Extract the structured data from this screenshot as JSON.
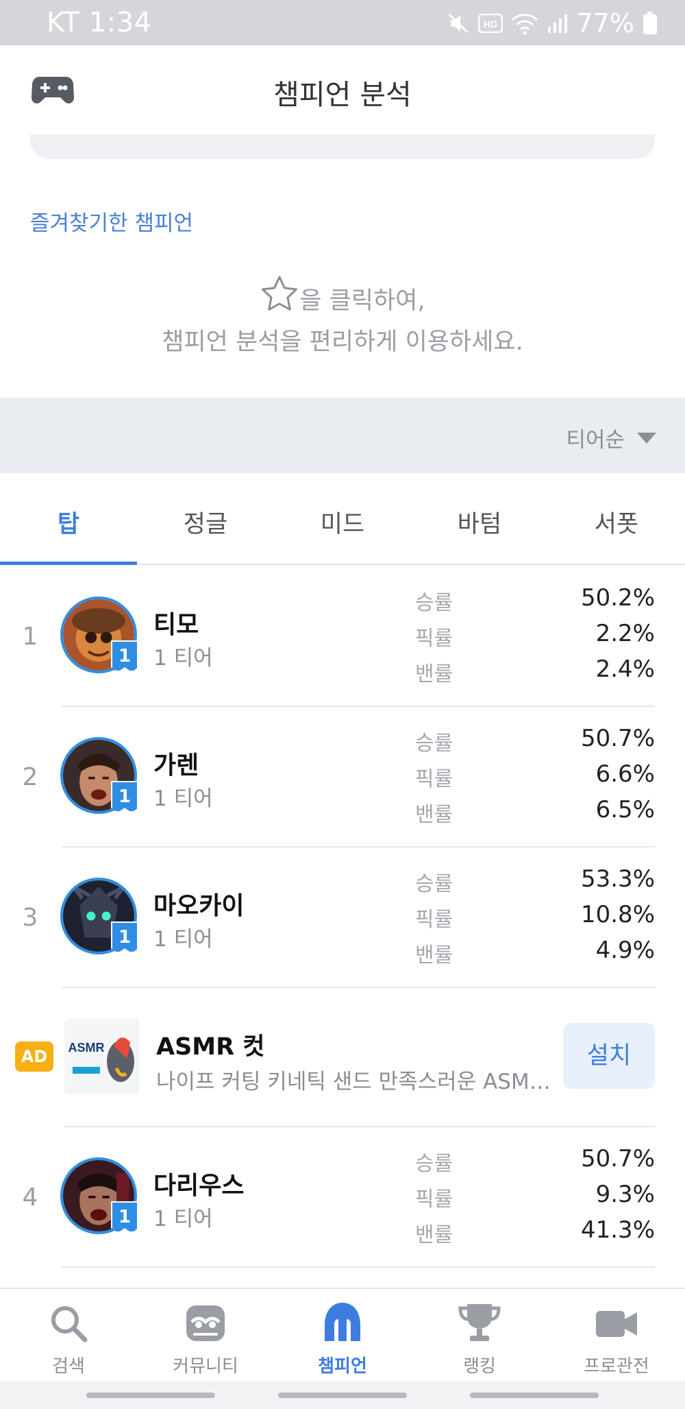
{
  "status_bar": {
    "carrier_time": "KT 1:34",
    "battery": "77%",
    "icons": [
      "mute-icon",
      "hd-icon",
      "wifi-icon",
      "signal-icon",
      "battery-icon"
    ]
  },
  "header": {
    "title": "챔피언 분석",
    "icon": "gamepad-icon"
  },
  "favorites": {
    "title": "즐겨찾기한 챔피언",
    "hint_line1": "을 클릭하여,",
    "hint_line2": "챔피언 분석을 편리하게 이용하세요.",
    "hint_icon": "star-outline-icon"
  },
  "sort": {
    "selected": "티어순",
    "icon": "dropdown-arrow-icon"
  },
  "tabs": [
    {
      "label": "탑",
      "active": true
    },
    {
      "label": "정글",
      "active": false
    },
    {
      "label": "미드",
      "active": false
    },
    {
      "label": "바텀",
      "active": false
    },
    {
      "label": "서폿",
      "active": false
    }
  ],
  "stat_labels": {
    "win": "승률",
    "pick": "픽률",
    "ban": "밴률"
  },
  "champions": [
    {
      "rank": "1",
      "name": "티모",
      "tier": "1 티어",
      "tier_badge": "1",
      "win": "50.2%",
      "pick": "2.2%",
      "ban": "2.4%"
    },
    {
      "rank": "2",
      "name": "가렌",
      "tier": "1 티어",
      "tier_badge": "1",
      "win": "50.7%",
      "pick": "6.6%",
      "ban": "6.5%"
    },
    {
      "rank": "3",
      "name": "마오카이",
      "tier": "1 티어",
      "tier_badge": "1",
      "win": "53.3%",
      "pick": "10.8%",
      "ban": "4.9%"
    },
    {
      "rank": "4",
      "name": "다리우스",
      "tier": "1 티어",
      "tier_badge": "1",
      "win": "50.7%",
      "pick": "9.3%",
      "ban": "41.3%"
    }
  ],
  "ad": {
    "badge": "AD",
    "title": "ASMR 컷",
    "description": "나이프 커팅 키네틱 샌드 만족스러운 ASMR 게임",
    "button": "설치",
    "image_text": "ASMR"
  },
  "bottom_nav": [
    {
      "label": "검색",
      "icon": "search-icon",
      "active": false
    },
    {
      "label": "커뮤니티",
      "icon": "community-icon",
      "active": false
    },
    {
      "label": "챔피언",
      "icon": "champion-helmet-icon",
      "active": true
    },
    {
      "label": "랭킹",
      "icon": "trophy-icon",
      "active": false
    },
    {
      "label": "프로관전",
      "icon": "video-camera-icon",
      "active": false
    }
  ],
  "colors": {
    "accent": "#3d7de0",
    "tier_badge": "#2f8de4",
    "ad_badge": "#f6b014"
  }
}
